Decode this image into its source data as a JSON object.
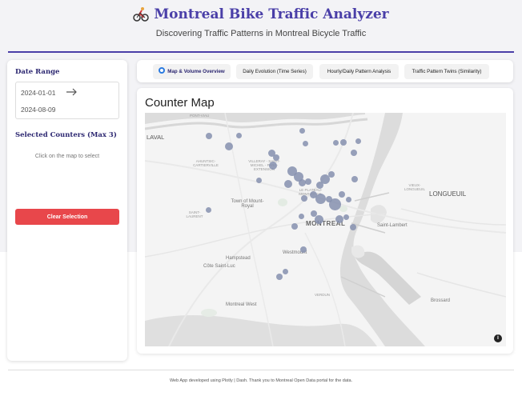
{
  "header": {
    "title": "Montreal Bike Traffic Analyzer",
    "subtitle": "Discovering Traffic Patterns in Montreal Bicycle Traffic",
    "icon": "cyclist-icon",
    "accent_color": "#4a3fa8"
  },
  "sidebar": {
    "date_range_label": "Date Range",
    "start_date": "2024-01-01",
    "end_date": "2024-08-09",
    "selected_counters_label": "Selected Counters (Max 3)",
    "select_hint": "Click on the map to select",
    "clear_button_label": "Clear Selection",
    "clear_button_color": "#e8474b"
  },
  "tabs": [
    {
      "label": "Map & Volume Overview",
      "active": true
    },
    {
      "label": "Daily Evolution (Time Series)",
      "active": false
    },
    {
      "label": "Hourly/Daily Pattern Analysis",
      "active": false
    },
    {
      "label": "Traffic Pattern Twins (Similarity)",
      "active": false
    }
  ],
  "map": {
    "title": "Counter Map",
    "labels": {
      "pont_viau": "PONT-VIAU",
      "laval": "LAVAL",
      "ahuntsic": "AHUNTSIC-CARTIERVILLE",
      "saint_michel": "VILLERAY - SAINT-MICHEL - PARC-EXTENSION",
      "le_plateau": "LE PLATEAU-MONT-ROYAL",
      "town_mount_royal": "Town of Mount-Royal",
      "saint_laurent": "SAINT-LAURENT",
      "montreal": "MONTREAL",
      "saint_lambert": "Saint-Lambert",
      "longueuil": "LONGUEUIL",
      "vieux_longueuil": "VIEUX-LONGUEUIL",
      "hampstead": "Hampstead",
      "cote_saint_luc": "Côte Saint-Luc",
      "westmount": "Westmount",
      "verdun": "VERDUN",
      "montreal_west": "Montreal West",
      "brossard": "Brossard"
    },
    "marker_color": "#858fae",
    "marker_count": 40
  },
  "footer": {
    "text": "Web App developed using Plotly | Dash. Thank you to Montreal Open Data portal for the data."
  }
}
